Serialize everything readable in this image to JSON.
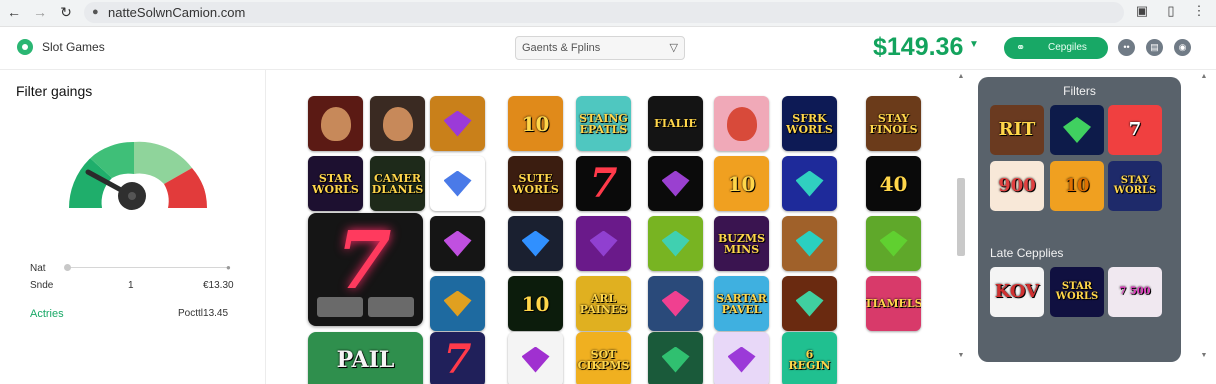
{
  "browser": {
    "url": "natteSolwnCamion.com",
    "icons": [
      "back-icon",
      "forward-icon",
      "reload-icon",
      "lock-icon",
      "screenshot-icon",
      "extensions-icon",
      "menu-icon"
    ]
  },
  "header": {
    "title": "Slot Games",
    "search_text": "Gaents & Fplins",
    "balance": "$149.36",
    "cta_label": "Cepgiles",
    "colors": {
      "accent": "#18a866",
      "balance": "#13a35d",
      "panel": "#59626b"
    }
  },
  "sidebar": {
    "title": "Filter gaings",
    "gauge_colors": [
      "#1fae6b",
      "#3fbf78",
      "#8fd49b",
      "#e23b3b"
    ],
    "rows": [
      {
        "label": "Nat",
        "value": ""
      },
      {
        "label": "Snde",
        "mid": "1",
        "value": "€13.30"
      },
      {
        "label": "Actries",
        "value": "Pocttl13.45"
      }
    ]
  },
  "grid": {
    "tiles": [
      {
        "label": "",
        "kind": "face"
      },
      {
        "label": "",
        "kind": "face"
      },
      {
        "label": "",
        "kind": "gem"
      },
      {
        "label": "10",
        "kind": "text"
      },
      {
        "label": "STAING EPATLS",
        "kind": "text"
      },
      {
        "label": "FIALIE",
        "kind": "text"
      },
      {
        "label": "",
        "kind": "face"
      },
      {
        "label": "SFRK WORLS",
        "kind": "text"
      },
      {
        "label": "STAY FINOLS",
        "kind": "text"
      },
      {
        "label": "STAR WORLS",
        "kind": "text"
      },
      {
        "label": "CAMER DLANLS",
        "kind": "text"
      },
      {
        "label": "",
        "kind": "gem"
      },
      {
        "label": "SUTE WORLS",
        "kind": "text"
      },
      {
        "label": "7",
        "kind": "seven"
      },
      {
        "label": "",
        "kind": "gem"
      },
      {
        "label": "10",
        "kind": "text"
      },
      {
        "label": "",
        "kind": "gem"
      },
      {
        "label": "40",
        "kind": "text"
      },
      {
        "label": "",
        "kind": "gem"
      },
      {
        "label": "",
        "kind": "gem"
      },
      {
        "label": "",
        "kind": "gem"
      },
      {
        "label": "",
        "kind": "gem"
      },
      {
        "label": "BUZMS MINS",
        "kind": "text"
      },
      {
        "label": "",
        "kind": "gem"
      },
      {
        "label": "",
        "kind": "gem"
      },
      {
        "label": "",
        "kind": "gem"
      },
      {
        "label": "10",
        "kind": "text"
      },
      {
        "label": "ARL PAINES",
        "kind": "text"
      },
      {
        "label": "",
        "kind": "gem"
      },
      {
        "label": "SARTAR PAVEL",
        "kind": "text"
      },
      {
        "label": "",
        "kind": "gem"
      },
      {
        "label": "TIAMELS",
        "kind": "text"
      },
      {
        "label": "7",
        "kind": "seven"
      },
      {
        "label": "",
        "kind": "gem"
      },
      {
        "label": "SOT CIKPMS",
        "kind": "text"
      },
      {
        "label": "",
        "kind": "gem"
      },
      {
        "label": "",
        "kind": "gem"
      },
      {
        "label": "6 REGIN",
        "kind": "text"
      }
    ],
    "big_tile_label": "7",
    "partial_tile_label": "PAIL"
  },
  "panel": {
    "title": "Filters",
    "subtitle": "Late Cepplies",
    "tiles": [
      "RIT",
      "",
      "7",
      "900",
      "10",
      "STAY WORLS",
      "KOV",
      "STAR WORLS",
      "7 500"
    ]
  }
}
